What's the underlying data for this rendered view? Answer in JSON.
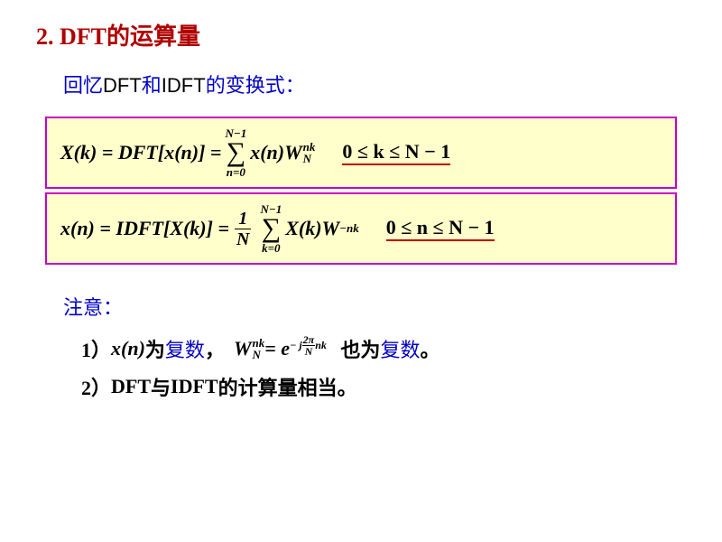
{
  "title": "2.  DFT的运算量",
  "intro": {
    "prefix": "回忆",
    "dft": "DFT",
    "mid": "和",
    "idft": "IDFT",
    "suffix": "的变换式："
  },
  "formula1": {
    "lhs": "X(k) = DFT[x(n)] =",
    "sum_top": "N−1",
    "sum_bot": "n=0",
    "term_xn": "x(n)W",
    "W_sup": "nk",
    "W_sub": "N",
    "cond": "0 ≤ k ≤ N − 1"
  },
  "formula2": {
    "lhs": "x(n) = IDFT[X(k)] =",
    "frac_num": "1",
    "frac_den": "N",
    "sum_top": "N−1",
    "sum_bot": "k=0",
    "term_Xk": "X(k)W",
    "W_sup": "−nk",
    "cond": "0 ≤ n ≤ N − 1"
  },
  "notes_label": "注意：",
  "note1": {
    "num": "1）",
    "xn": "x(n)",
    "wei": "为",
    "fushu": "复数",
    "comma": "，",
    "W": "W",
    "W_sup": "nk",
    "W_sub": "N",
    "eq": " = e",
    "exp_prefix": "− j",
    "exp_frac_num": "2π",
    "exp_frac_den": "N",
    "exp_suffix": "nk",
    "also": "也为复数。"
  },
  "note2": {
    "num": "2）",
    "dft": "DFT",
    "yu": "与",
    "idft": "IDFT",
    "text": "的计算量相当。"
  }
}
